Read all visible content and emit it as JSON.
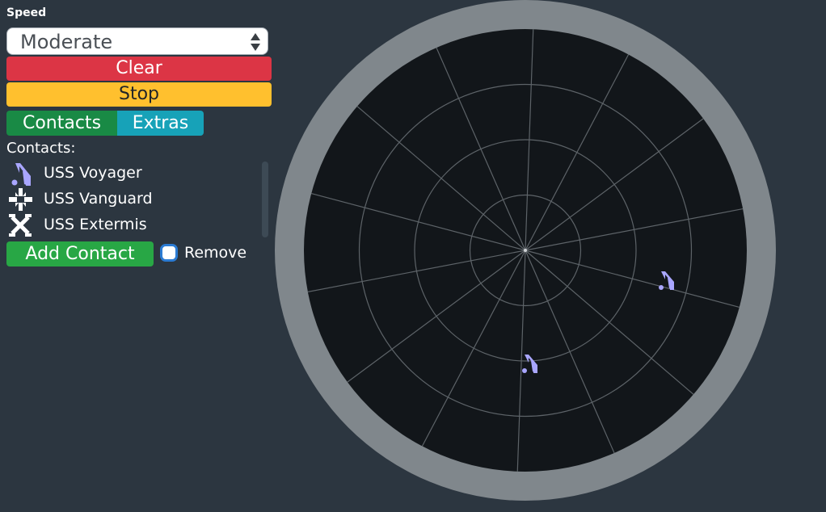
{
  "sidebar": {
    "speed_label": "Speed",
    "speed_select": {
      "value": "Moderate"
    },
    "clear_label": "Clear",
    "stop_label": "Stop",
    "tabs": [
      {
        "label": "Contacts",
        "color": "#198a45"
      },
      {
        "label": "Extras",
        "color": "#17a2b8"
      }
    ],
    "contacts_heading": "Contacts:",
    "contacts": [
      {
        "name": "USS Voyager",
        "icon": "voyager-ship-icon"
      },
      {
        "name": "USS Vanguard",
        "icon": "vanguard-ship-icon"
      },
      {
        "name": "USS Extermis",
        "icon": "extermis-ship-icon"
      }
    ],
    "add_contact_label": "Add Contact",
    "remove_label": "Remove",
    "remove_checked": false
  },
  "radar": {
    "rings": 3,
    "spokes": 14,
    "blips": [
      {
        "contact": "USS Voyager",
        "icon": "voyager-ship-icon",
        "color": "#a9a6ff"
      },
      {
        "contact": "USS Voyager",
        "icon": "voyager-ship-icon",
        "color": "#a9a6ff"
      }
    ]
  },
  "colors": {
    "background": "#2c3640",
    "radar_bezel": "#80878c",
    "radar_screen": "#12161a",
    "clear": "#dc3545",
    "stop": "#ffc02e",
    "add_contact": "#28a745",
    "blip": "#a9a6ff"
  }
}
